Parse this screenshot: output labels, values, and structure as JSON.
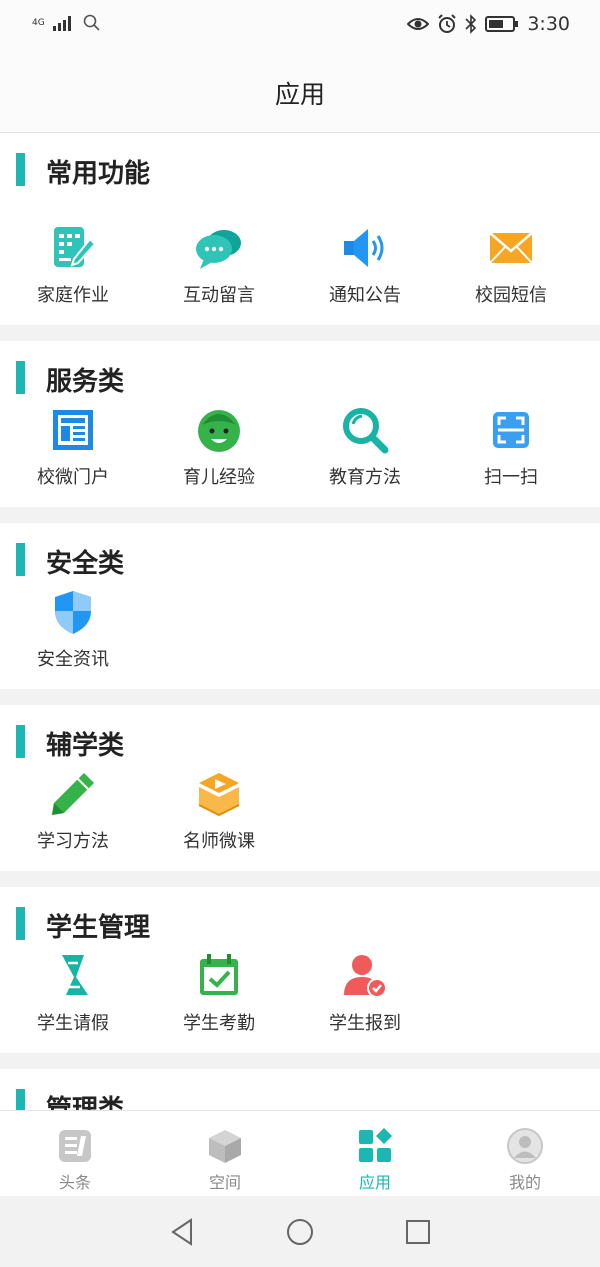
{
  "status_bar": {
    "network": "4G",
    "time": "3:30"
  },
  "header": {
    "title": "应用"
  },
  "sections": [
    {
      "title": "常用功能",
      "items": [
        {
          "label": "家庭作业",
          "icon": "homework-icon"
        },
        {
          "label": "互动留言",
          "icon": "chat-bubbles-icon"
        },
        {
          "label": "通知公告",
          "icon": "speaker-icon"
        },
        {
          "label": "校园短信",
          "icon": "envelope-icon"
        }
      ]
    },
    {
      "title": "服务类",
      "items": [
        {
          "label": "校微门户",
          "icon": "portal-icon"
        },
        {
          "label": "育儿经验",
          "icon": "baby-face-icon"
        },
        {
          "label": "教育方法",
          "icon": "magnifier-icon"
        },
        {
          "label": "扫一扫",
          "icon": "scan-icon"
        }
      ]
    },
    {
      "title": "安全类",
      "items": [
        {
          "label": "安全资讯",
          "icon": "shield-icon"
        }
      ]
    },
    {
      "title": "辅学类",
      "items": [
        {
          "label": "学习方法",
          "icon": "pencil-icon"
        },
        {
          "label": "名师微课",
          "icon": "video-course-icon"
        }
      ]
    },
    {
      "title": "学生管理",
      "items": [
        {
          "label": "学生请假",
          "icon": "leave-icon"
        },
        {
          "label": "学生考勤",
          "icon": "calendar-check-icon"
        },
        {
          "label": "学生报到",
          "icon": "user-check-icon"
        }
      ]
    },
    {
      "title": "管理类",
      "items": []
    }
  ],
  "tabs": [
    {
      "label": "头条",
      "icon": "news-icon",
      "active": false
    },
    {
      "label": "空间",
      "icon": "cube-icon",
      "active": false
    },
    {
      "label": "应用",
      "icon": "apps-grid-icon",
      "active": true
    },
    {
      "label": "我的",
      "icon": "profile-icon",
      "active": false
    }
  ],
  "colors": {
    "accent": "#1ab7b3",
    "inactive": "#8a8a8a",
    "orange": "#f6a623",
    "green": "#35b34a",
    "red": "#f05a5a"
  }
}
